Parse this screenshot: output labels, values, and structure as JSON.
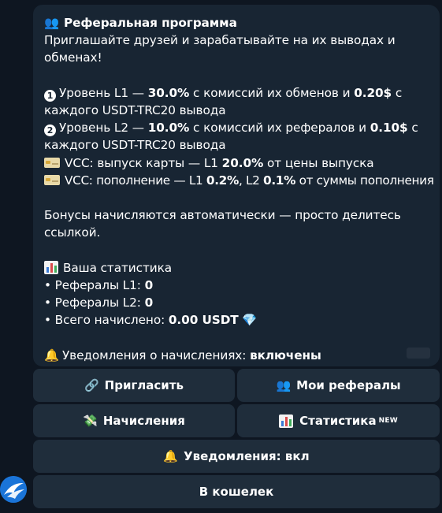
{
  "message": {
    "title": "Реферальная программа",
    "intro": "Приглашайте друзей и зарабатывайте на их выводах и обменах!",
    "level1": {
      "prefix": "Уровень L1 — ",
      "percent": "30.0%",
      "middle": " с комиссий их обменов и ",
      "amount": "0.20$",
      "suffix": " с каждого USDT-TRC20 вывода"
    },
    "level2": {
      "prefix": "Уровень L2 — ",
      "percent": "10.0%",
      "middle": " с комиссий их рефералов и ",
      "amount": "0.10$",
      "suffix": " с каждого USDT-TRC20 вывода"
    },
    "vcc_issue": {
      "prefix": "VCC: выпуск карты — L1 ",
      "percent": "20.0%",
      "suffix": " от цены выпуска"
    },
    "vcc_topup": {
      "prefix": "VCC: пополнение — L1 ",
      "l1": "0.2%",
      "mid": ", L2 ",
      "l2": "0.1%",
      "suffix": " от суммы пополнения"
    },
    "bonus_note": "Бонусы начисляются автоматически — просто делитесь ссылкой.",
    "stats_title": "Ваша статистика",
    "stats": {
      "ref_l1_label": "• Рефералы L1: ",
      "ref_l1_value": "0",
      "ref_l2_label": "• Рефералы L2: ",
      "ref_l2_value": "0",
      "total_label": "• Всего начислено: ",
      "total_value": "0.00 USDT"
    },
    "notify_label": "Уведомления о начислениях: ",
    "notify_value": "включены"
  },
  "buttons": {
    "invite": "Пригласить",
    "my_referrals": "Мои рефералы",
    "accruals": "Начисления",
    "statistics": "Статистика",
    "statistics_badge": "NEW",
    "notifications": "Уведомления: вкл",
    "wallet": "В кошелек"
  },
  "icons": {
    "title": "busts-in-silhouette-icon",
    "level1": "digit-one-icon",
    "level2": "digit-two-icon",
    "vcc": "credit-card-icon",
    "stats": "bar-chart-icon",
    "total": "gem-icon",
    "notify": "bell-icon",
    "invite": "link-icon",
    "my_referrals": "busts-in-silhouette-icon",
    "accruals": "money-with-wings-icon"
  },
  "colors": {
    "background": "#0e1621",
    "bubble": "#182533",
    "button": "#1f2d3b",
    "avatar": "#1a74d8"
  }
}
